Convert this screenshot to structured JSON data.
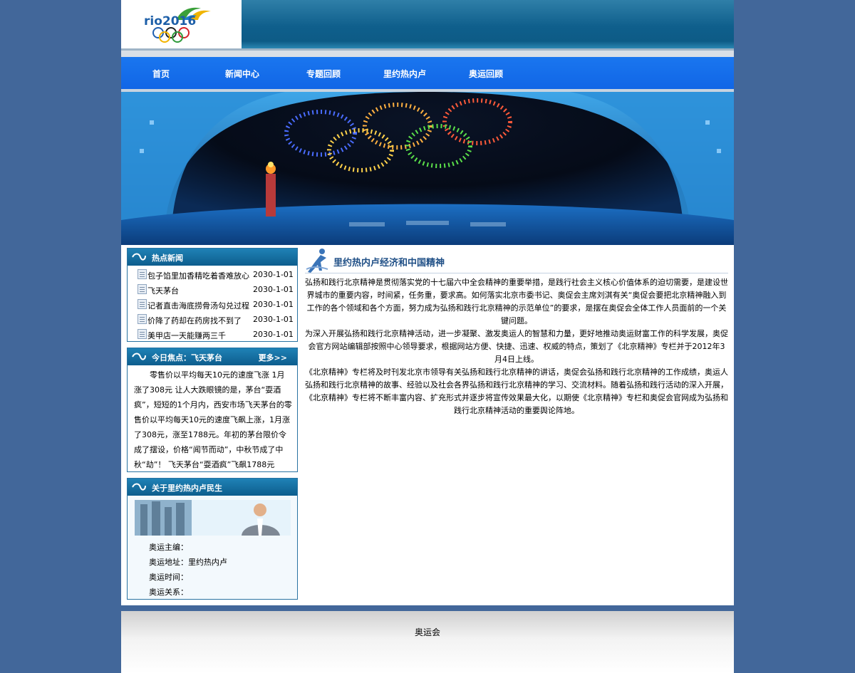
{
  "logo": {
    "text": "rio2016",
    "alt": "rio 2016 logo"
  },
  "nav": {
    "items": [
      "首页",
      "新闻中心",
      "专题回顾",
      "里约热内卢",
      "奥运回顾"
    ]
  },
  "hot_news": {
    "title": "热点新闻",
    "items": [
      {
        "title": "包子馅里加香精吃着香难放心",
        "date": "2030-1-01"
      },
      {
        "title": "飞天茅台",
        "date": "2030-1-01"
      },
      {
        "title": "记者直击海底捞骨汤勾兑过程",
        "date": "2030-1-01"
      },
      {
        "title": "价降了药却在药房找不到了",
        "date": "2030-1-01"
      },
      {
        "title": "美甲店一天能赚两三千",
        "date": "2030-1-01"
      }
    ]
  },
  "focus": {
    "title": "今日焦点：飞天茅台",
    "more": "更多>>",
    "text": "零售价以平均每天10元的速度飞涨 1月涨了308元 让人大跌眼镜的是，茅台“耍酒疯”，短短的1个月内，西安市场飞天茅台的零售价以平均每天10元的速度飞飙上涨，1月涨了308元，涨至1788元。年初的茅台限价令成了摆设，价格“闻节而动”，中秋节成了中秋“劫”！ 飞天茅台“耍酒疯”飞飙1788元"
  },
  "about": {
    "title": "关于里约热内卢民生",
    "lines": [
      "奥运主编：",
      "奥运地址：里约热内卢",
      "奥运时间：",
      "奥运关系："
    ]
  },
  "article": {
    "title": "里约热内卢经济和中国精神",
    "paragraphs": [
      "弘扬和践行北京精神是贯彻落实党的十七届六中全会精神的重要举措，是践行社会主义核心价值体系的迫切需要，是建设世界城市的重要内容，时间紧，任务重，要求高。如何落实北京市委书记、奥促会主席刘淇有关“奥促会要把北京精神融入到工作的各个领域和各个方面，努力成为弘扬和践行北京精神的示范单位”的要求，是摆在奥促会全体工作人员面前的一个关键问题。",
      "为深入开展弘扬和践行北京精神活动，进一步凝聚、激发奥运人的智慧和力量，更好地推动奥运财富工作的科学发展，奥促会官方网站编辑部按照中心领导要求，根据网站方便、快捷、迅速、权威的特点，策划了《北京精神》专栏并于2012年3月4日上线。",
      "《北京精神》专栏将及时刊发北京市领导有关弘扬和践行北京精神的讲话，奥促会弘扬和践行北京精神的工作成绩，奥运人弘扬和践行北京精神的故事、经验以及社会各界弘扬和践行北京精神的学习、交流材料。随着弘扬和践行活动的深入开展，《北京精神》专栏将不断丰富内容、扩充形式并逐步将宣传效果最大化，以期使《北京精神》专栏和奥促会官网成为弘扬和践行北京精神活动的重要舆论阵地。"
    ]
  },
  "footer": {
    "text": "奥运会"
  },
  "colors": {
    "page_bg": "#42679a",
    "nav_bg": "#1469ea",
    "box_head": "#1577ab",
    "title_blue": "#1f4f86"
  }
}
